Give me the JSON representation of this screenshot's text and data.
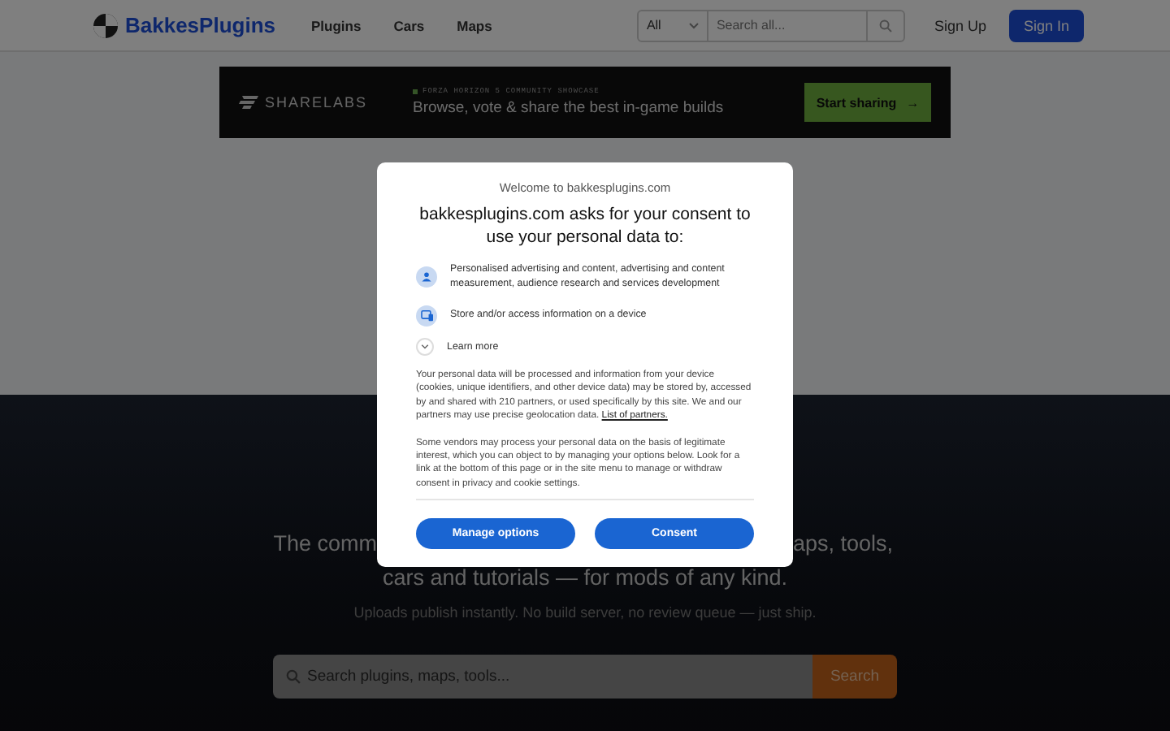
{
  "header": {
    "logo": "BakkesPlugins",
    "nav": [
      "Plugins",
      "Cars",
      "Maps"
    ],
    "category_select": "All",
    "search": {
      "placeholder": "Search all..."
    },
    "sign_up": "Sign Up",
    "sign_in": "Sign In"
  },
  "ad": {
    "brand": "SHARELABS",
    "eyebrow": "FORZA HORIZON 5 COMMUNITY SHOWCASE",
    "headline": "Browse, vote & share the best in-game builds",
    "cta": "Start sharing",
    "cta_arrow": "→"
  },
  "hero": {
    "tagline_start": "The comm",
    "tagline_end": "aps, tools,",
    "tagline_line2": "cars and tutorials — for mods of any kind.",
    "subtitle": "Uploads publish instantly. No build server, no review queue — just ship.",
    "search": {
      "placeholder": "Search plugins, maps, tools...",
      "button": "Search"
    }
  },
  "consent": {
    "title": "Welcome to bakkesplugins.com",
    "heading": "bakkesplugins.com asks for your consent to use your personal data to:",
    "purposes": [
      {
        "kind": "person",
        "text": "Personalised advertising and content, advertising and content measurement, audience research and services development"
      },
      {
        "kind": "device",
        "text": "Store and/or access information on a device"
      }
    ],
    "learn_more": "Learn more",
    "paragraphs": [
      {
        "text": "Your personal data will be processed and information from your device (cookies, unique identifiers, and other device data) may be stored by, accessed by and shared with 210 partners, or used specifically by this site. We and our partners may use precise geolocation data.",
        "link": "List of partners."
      },
      {
        "text": "Some vendors may process your personal data on the basis of legitimate interest, which you can object to by managing your options below. Look for a link at the bottom of this page or in the site menu to manage or withdraw consent in privacy and cookie settings."
      }
    ],
    "buttons": [
      "Manage options",
      "Consent"
    ]
  }
}
